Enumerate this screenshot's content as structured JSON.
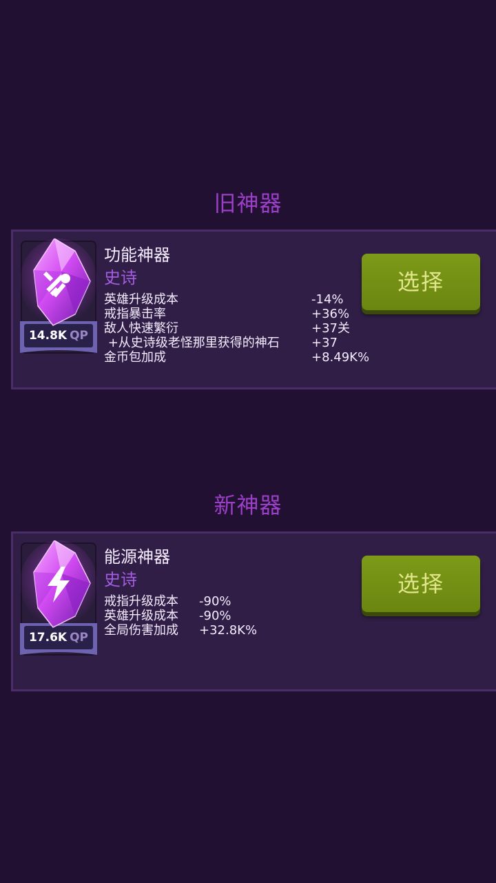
{
  "old_section": {
    "title": "旧神器",
    "artifact": {
      "name": "功能神器",
      "rarity": "史诗",
      "qp_value": "14.8K",
      "qp_unit": "QP",
      "gem_icon": "tools-icon",
      "stats": [
        {
          "label": "英雄升级成本",
          "value": "-14%"
        },
        {
          "label": "戒指暴击率",
          "value": "+36%"
        },
        {
          "label": "敌人快速繁衍",
          "value": "+37关"
        },
        {
          "label": " +从史诗级老怪那里获得的神石",
          "value": "+37"
        },
        {
          "label": "金币包加成",
          "value": "+8.49K%"
        }
      ],
      "select_label": "选择"
    }
  },
  "new_section": {
    "title": "新神器",
    "artifact": {
      "name": "能源神器",
      "rarity": "史诗",
      "qp_value": "17.6K",
      "qp_unit": "QP",
      "gem_icon": "lightning-icon",
      "stats": [
        {
          "label": "戒指升级成本",
          "value": "-90%"
        },
        {
          "label": "英雄升级成本",
          "value": "-90%"
        },
        {
          "label": "全局伤害加成",
          "value": "+32.8K%"
        }
      ],
      "select_label": "选择"
    }
  },
  "colors": {
    "background": "#221033",
    "card": "#301e46",
    "title": "#9b3fc7",
    "rarity": "#a45de0",
    "button": "#7e9a18",
    "button_text": "#e3e78c"
  }
}
